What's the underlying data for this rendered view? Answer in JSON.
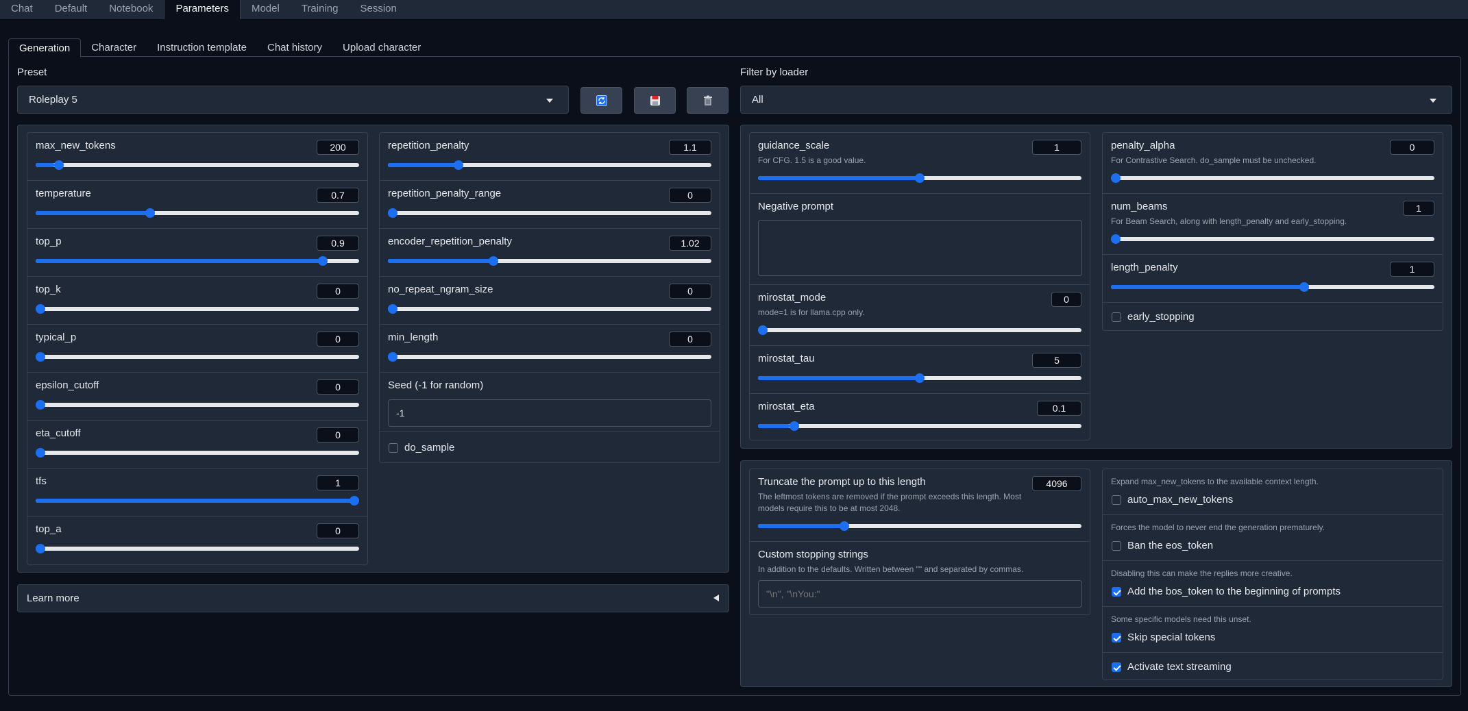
{
  "top_tabs": [
    "Chat",
    "Default",
    "Notebook",
    "Parameters",
    "Model",
    "Training",
    "Session"
  ],
  "active_top_tab": "Parameters",
  "sub_tabs": [
    "Generation",
    "Character",
    "Instruction template",
    "Chat history",
    "Upload character"
  ],
  "active_sub_tab": "Generation",
  "preset": {
    "label": "Preset",
    "value": "Roleplay 5"
  },
  "filter": {
    "label": "Filter by loader",
    "value": "All"
  },
  "colors": {
    "accent": "#1d6ff2",
    "panel": "#1f2937",
    "background": "#0b0f19"
  },
  "left_col1": [
    {
      "label": "max_new_tokens",
      "value": "200",
      "fraction": 0.06
    },
    {
      "label": "temperature",
      "value": "0.7",
      "fraction": 0.35
    },
    {
      "label": "top_p",
      "value": "0.9",
      "fraction": 0.9
    },
    {
      "label": "top_k",
      "value": "0",
      "fraction": 0.0
    },
    {
      "label": "typical_p",
      "value": "0",
      "fraction": 0.0
    },
    {
      "label": "epsilon_cutoff",
      "value": "0",
      "fraction": 0.0
    },
    {
      "label": "eta_cutoff",
      "value": "0",
      "fraction": 0.0
    },
    {
      "label": "tfs",
      "value": "1",
      "fraction": 1.0
    },
    {
      "label": "top_a",
      "value": "0",
      "fraction": 0.0
    }
  ],
  "left_col2": [
    {
      "label": "repetition_penalty",
      "value": "1.1",
      "fraction": 0.21
    },
    {
      "label": "repetition_penalty_range",
      "value": "0",
      "fraction": 0.0
    },
    {
      "label": "encoder_repetition_penalty",
      "value": "1.02",
      "fraction": 0.32
    },
    {
      "label": "no_repeat_ngram_size",
      "value": "0",
      "fraction": 0.0
    },
    {
      "label": "min_length",
      "value": "0",
      "fraction": 0.0
    }
  ],
  "seed": {
    "label": "Seed (-1 for random)",
    "value": "-1"
  },
  "do_sample": {
    "label": "do_sample",
    "checked": false
  },
  "learn_more": "Learn more",
  "cfg": {
    "guidance_scale": {
      "label": "guidance_scale",
      "info": "For CFG. 1.5 is a good value.",
      "value": "1",
      "fraction": 0.5
    },
    "negative_prompt": {
      "label": "Negative prompt",
      "value": ""
    },
    "mirostat_mode": {
      "label": "mirostat_mode",
      "info": "mode=1 is for llama.cpp only.",
      "value": "0",
      "fraction": 0.0
    },
    "mirostat_tau": {
      "label": "mirostat_tau",
      "value": "5",
      "fraction": 0.5
    },
    "mirostat_eta": {
      "label": "mirostat_eta",
      "value": "0.1",
      "fraction": 0.1
    }
  },
  "contrastive": {
    "penalty_alpha": {
      "label": "penalty_alpha",
      "info": "For Contrastive Search. do_sample must be unchecked.",
      "value": "0",
      "fraction": 0.0
    },
    "num_beams": {
      "label": "num_beams",
      "info": "For Beam Search, along with length_penalty and early_stopping.",
      "value": "1",
      "fraction": 0.0
    },
    "length_penalty": {
      "label": "length_penalty",
      "value": "1",
      "fraction": 0.6
    },
    "early_stopping": {
      "label": "early_stopping",
      "checked": false
    }
  },
  "truncate": {
    "label": "Truncate the prompt up to this length",
    "info": "The leftmost tokens are removed if the prompt exceeds this length. Most models require this to be at most 2048.",
    "value": "4096",
    "fraction": 0.26
  },
  "stopping": {
    "label": "Custom stopping strings",
    "info": "In addition to the defaults. Written between \"\" and separated by commas.",
    "placeholder": "\"\\n\", \"\\nYou:\""
  },
  "options": [
    {
      "info": "Expand max_new_tokens to the available context length.",
      "label": "auto_max_new_tokens",
      "checked": false
    },
    {
      "info": "Forces the model to never end the generation prematurely.",
      "label": "Ban the eos_token",
      "checked": false
    },
    {
      "info": "Disabling this can make the replies more creative.",
      "label": "Add the bos_token to the beginning of prompts",
      "checked": true
    },
    {
      "info": "Some specific models need this unset.",
      "label": "Skip special tokens",
      "checked": true
    },
    {
      "info": "",
      "label": "Activate text streaming",
      "checked": true
    }
  ]
}
